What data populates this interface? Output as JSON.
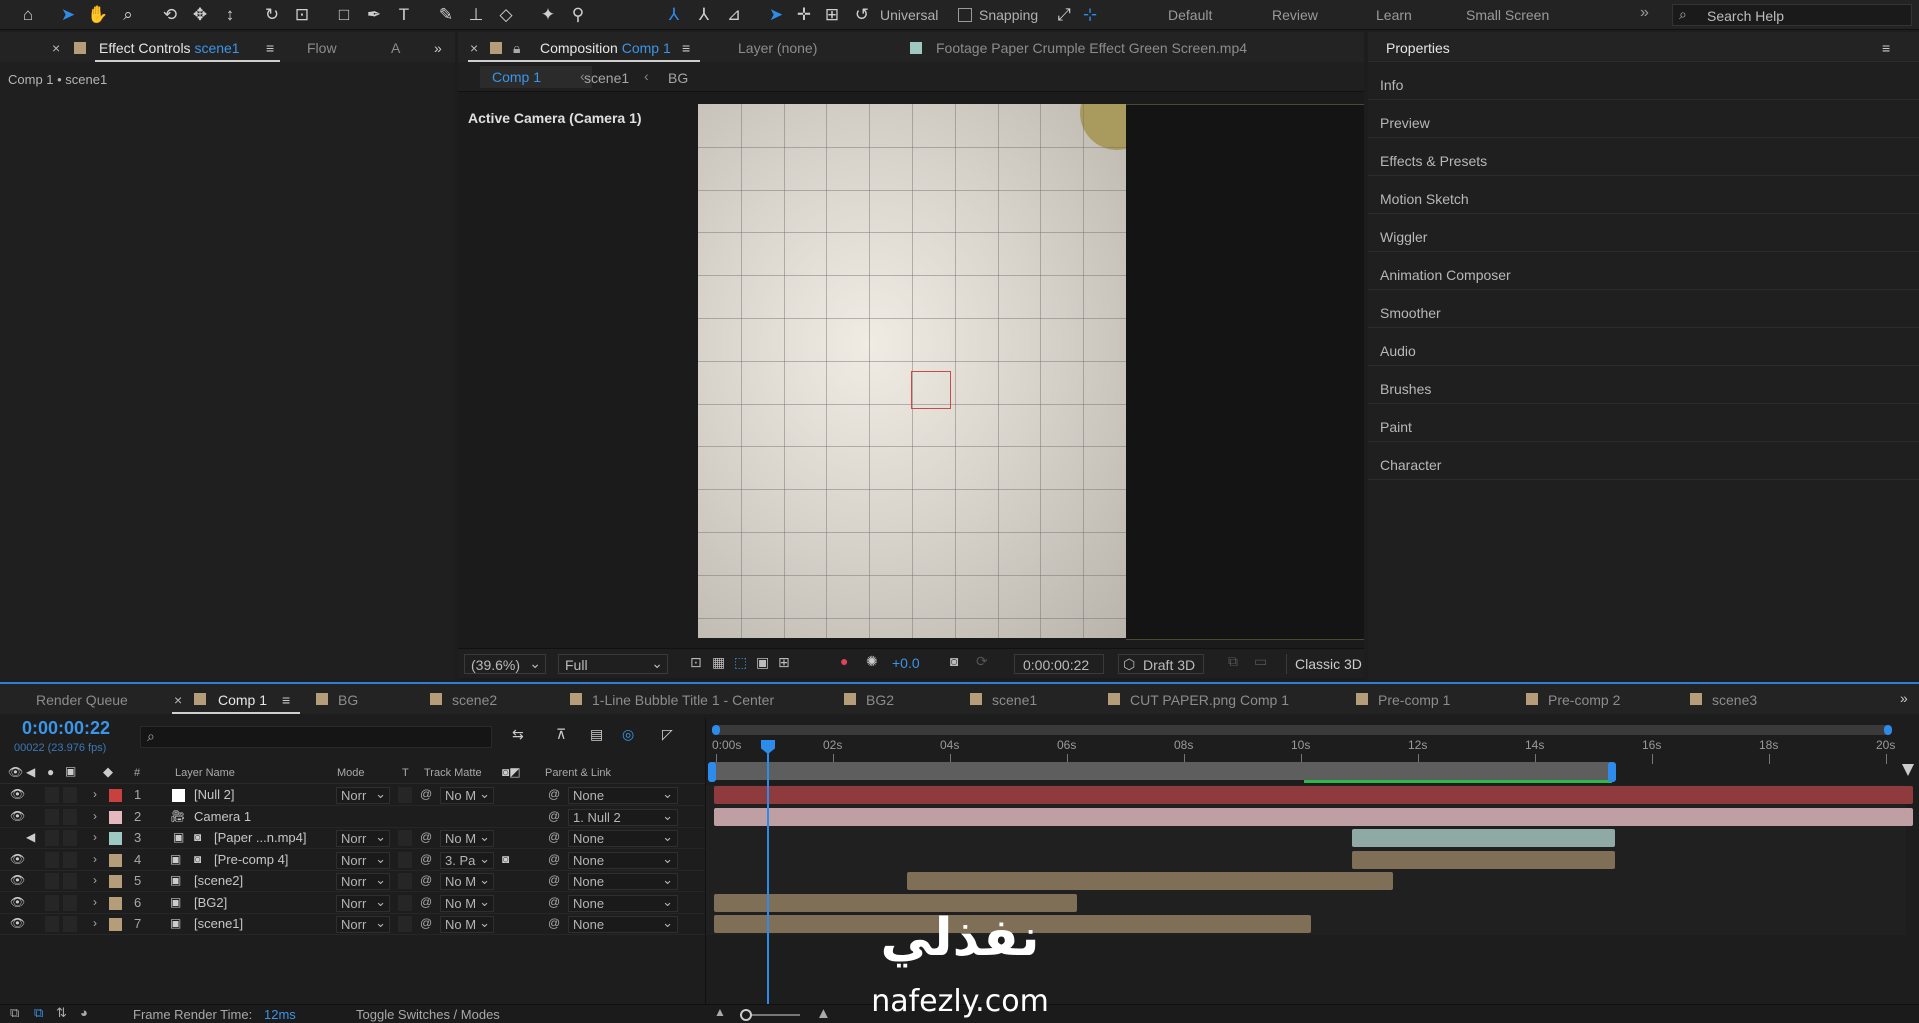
{
  "toolbar": {
    "universal_label": "Universal",
    "snapping_label": "Snapping",
    "workspaces": [
      "Default",
      "Review",
      "Learn",
      "Small Screen"
    ],
    "search_placeholder": "Search Help"
  },
  "left_panel": {
    "tab_effect_controls": "Effect Controls",
    "tab_effect_controls_target": "scene1",
    "tab_flow": "Flow",
    "tab_a": "A",
    "breadcrumb": "Comp 1 • scene1"
  },
  "viewer": {
    "tab_composition": "Composition",
    "tab_composition_target": "Comp 1",
    "tab_layer": "Layer  (none)",
    "tab_footage": "Footage  Paper Crumple Effect Green Screen.mp4",
    "crumbs": [
      "Comp 1",
      "scene1",
      "BG"
    ],
    "camera_label": "Active Camera (Camera 1)",
    "zoom": "(39.6%)",
    "resolution": "Full",
    "exposure": "+0.0",
    "timecode": "0:00:00:22",
    "renderer": "Draft 3D",
    "renderer2": "Classic 3D"
  },
  "properties": {
    "title": "Properties",
    "items": [
      "Info",
      "Preview",
      "Effects & Presets",
      "Motion Sketch",
      "Wiggler",
      "Animation Composer",
      "Smoother",
      "Audio",
      "Brushes",
      "Paint",
      "Character"
    ]
  },
  "timeline": {
    "tabs": [
      {
        "label": "Render Queue",
        "color": ""
      },
      {
        "label": "Comp 1",
        "color": "#b49d78"
      },
      {
        "label": "BG",
        "color": "#b49d78"
      },
      {
        "label": "scene2",
        "color": "#b49d78"
      },
      {
        "label": "1-Line Bubble Title 1 - Center",
        "color": "#b49d78"
      },
      {
        "label": "BG2",
        "color": "#b49d78"
      },
      {
        "label": "scene1",
        "color": "#b49d78"
      },
      {
        "label": "CUT PAPER.png Comp 1",
        "color": "#b49d78"
      },
      {
        "label": "Pre-comp 1",
        "color": "#b49d78"
      },
      {
        "label": "Pre-comp 2",
        "color": "#b49d78"
      },
      {
        "label": "scene3",
        "color": "#b49d78"
      }
    ],
    "current_time": "0:00:00:22",
    "frame_info": "00022 (23.976 fps)",
    "columns": {
      "num": "#",
      "layer_name": "Layer Name",
      "mode": "Mode",
      "t": "T",
      "track_matte": "Track Matte",
      "parent": "Parent & Link"
    },
    "ruler": [
      "0:00s",
      "02s",
      "04s",
      "06s",
      "08s",
      "10s",
      "12s",
      "14s",
      "16s",
      "18s",
      "20s"
    ],
    "layers": [
      {
        "num": "1",
        "name": "[Null 2]",
        "label_color": "#c9413f",
        "mode": "Norr",
        "matte": "No M",
        "parent": "None",
        "bar_color": "#8f3b3e",
        "bar_start": 0,
        "bar_end": 20.5
      },
      {
        "num": "2",
        "name": "Camera 1",
        "label_color": "#e5b8c0",
        "mode": "",
        "matte": "",
        "parent": "1. Null 2",
        "bar_color": "#bf9fa4",
        "bar_start": 0,
        "bar_end": 20.5
      },
      {
        "num": "3",
        "name": "[Paper ...n.mp4]",
        "label_color": "#9ec9c3",
        "mode": "Norr",
        "matte": "No M",
        "parent": "None",
        "bar_color": "#8fa9a5",
        "bar_start": 10.9,
        "bar_end": 15.4
      },
      {
        "num": "4",
        "name": "[Pre-comp 4]",
        "label_color": "#b49d78",
        "mode": "Norr",
        "matte": "3. Pa",
        "parent": "None",
        "bar_color": "#7f6f57",
        "bar_start": 10.9,
        "bar_end": 15.4
      },
      {
        "num": "5",
        "name": "[scene2]",
        "label_color": "#b49d78",
        "mode": "Norr",
        "matte": "No M",
        "parent": "None",
        "bar_color": "#7f6f57",
        "bar_start": 3.3,
        "bar_end": 11.6
      },
      {
        "num": "6",
        "name": "[BG2]",
        "label_color": "#b49d78",
        "mode": "Norr",
        "matte": "No M",
        "parent": "None",
        "bar_color": "#7f6f57",
        "bar_start": 0,
        "bar_end": 6.2
      },
      {
        "num": "7",
        "name": "[scene1]",
        "label_color": "#b49d78",
        "mode": "Norr",
        "matte": "No M",
        "parent": "None",
        "bar_color": "#7f6f57",
        "bar_start": 0,
        "bar_end": 10.2
      }
    ],
    "frame_render_label": "Frame Render Time:",
    "frame_render_value": "12ms",
    "toggle_label": "Toggle Switches / Modes"
  },
  "watermark": {
    "arabic": "نفذلي",
    "latin": "nafezly.com"
  }
}
